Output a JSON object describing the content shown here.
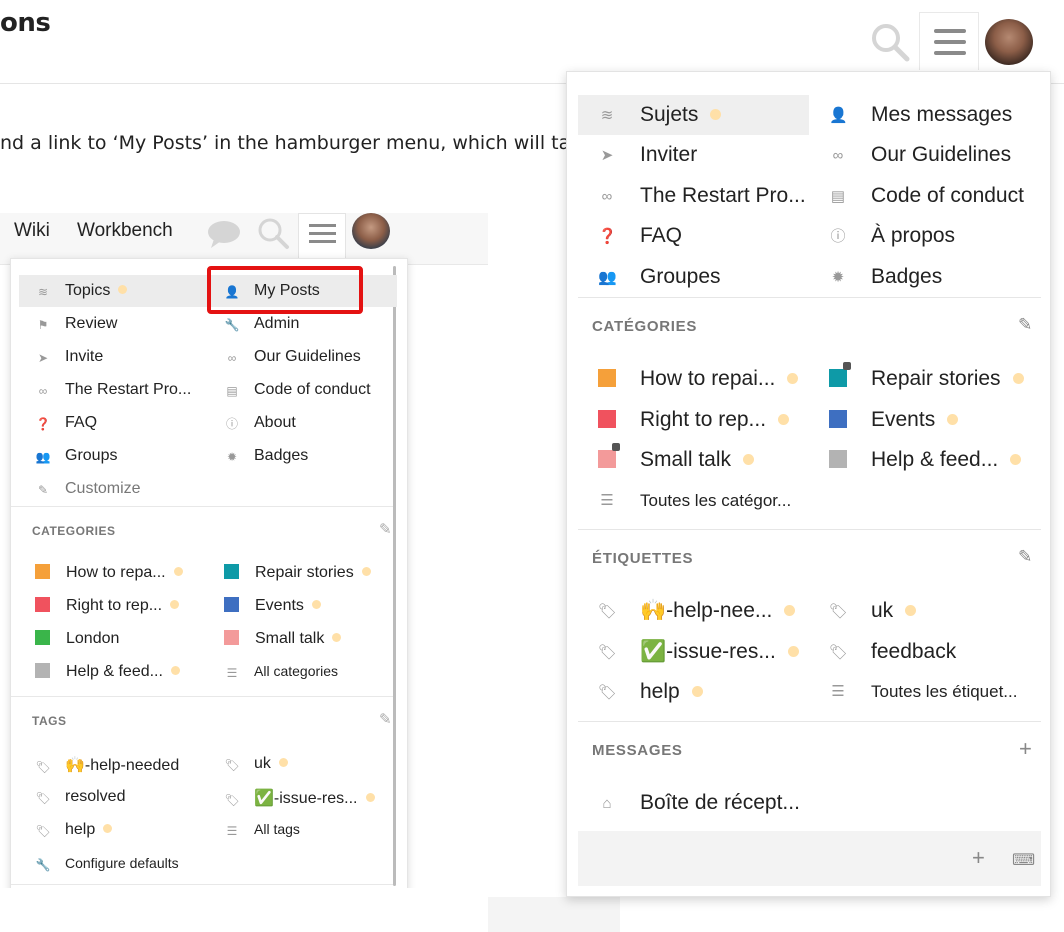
{
  "header": {
    "title": "ons"
  },
  "body": {
    "text": "nd a link to ‘My Posts’ in the hamburger menu, which will take"
  },
  "shot": {
    "nav": {
      "wiki": "Wiki",
      "workbench": "Workbench"
    },
    "left": [
      {
        "label": "Topics",
        "dot": true
      },
      {
        "label": "Review"
      },
      {
        "label": "Invite"
      },
      {
        "label": "The Restart Pro..."
      },
      {
        "label": "FAQ"
      },
      {
        "label": "Groups"
      },
      {
        "label": "Customize"
      }
    ],
    "right": [
      {
        "label": "My Posts"
      },
      {
        "label": "Admin"
      },
      {
        "label": "Our Guidelines"
      },
      {
        "label": "Code of conduct"
      },
      {
        "label": "About"
      },
      {
        "label": "Badges"
      }
    ],
    "categories_header": "CATEGORIES",
    "categories": [
      {
        "label": "How to repa...",
        "color": "#f5a03a",
        "dot": true
      },
      {
        "label": "Repair stories",
        "color": "#0e9aa7",
        "dot": true,
        "lock": true
      },
      {
        "label": "Right to rep...",
        "color": "#f0525e",
        "dot": true
      },
      {
        "label": "Events",
        "color": "#3e6fc1",
        "dot": true
      },
      {
        "label": "London",
        "color": "#3ab54a",
        "lock": true
      },
      {
        "label": "Small talk",
        "color": "#f39a9a",
        "dot": true,
        "lock": true
      },
      {
        "label": "Help & feed...",
        "color": "#b3b3b3",
        "dot": true
      },
      {
        "label": "All categories"
      }
    ],
    "tags_header": "TAGS",
    "tags": [
      {
        "label": "🙌-help-needed"
      },
      {
        "label": "uk",
        "dot": true
      },
      {
        "label": "resolved"
      },
      {
        "label": "✅-issue-res...",
        "dot": true
      },
      {
        "label": "help",
        "dot": true
      },
      {
        "label": "All tags"
      }
    ],
    "configure": "Configure defaults"
  },
  "dropdown": {
    "left": [
      {
        "label": "Sujets",
        "dot": true
      },
      {
        "label": "Inviter"
      },
      {
        "label": "The Restart Pro..."
      },
      {
        "label": "FAQ"
      },
      {
        "label": "Groupes"
      }
    ],
    "right": [
      {
        "label": "Mes messages"
      },
      {
        "label": "Our Guidelines"
      },
      {
        "label": "Code of conduct"
      },
      {
        "label": "À propos"
      },
      {
        "label": "Badges"
      }
    ],
    "categories_header": "CATÉGORIES",
    "categories": [
      {
        "label": "How to repai...",
        "color": "#f5a03a",
        "dot": true
      },
      {
        "label": "Repair stories",
        "color": "#0e9aa7",
        "dot": true,
        "lock": true
      },
      {
        "label": "Right to rep...",
        "color": "#f0525e",
        "dot": true
      },
      {
        "label": "Events",
        "color": "#3e6fc1",
        "dot": true
      },
      {
        "label": "Small talk",
        "color": "#f39a9a",
        "dot": true,
        "lock": true
      },
      {
        "label": "Help & feed...",
        "color": "#b3b3b3",
        "dot": true
      }
    ],
    "all_categories": "Toutes les catégor...",
    "tags_header": "ÉTIQUETTES",
    "tags": [
      {
        "label": "🙌-help-nee...",
        "dot": true
      },
      {
        "label": "uk",
        "dot": true
      },
      {
        "label": "✅-issue-res...",
        "dot": true
      },
      {
        "label": "feedback"
      },
      {
        "label": "help",
        "dot": true
      }
    ],
    "all_tags": "Toutes les étiquet...",
    "messages_header": "MESSAGES",
    "inbox": "Boîte de récept..."
  }
}
